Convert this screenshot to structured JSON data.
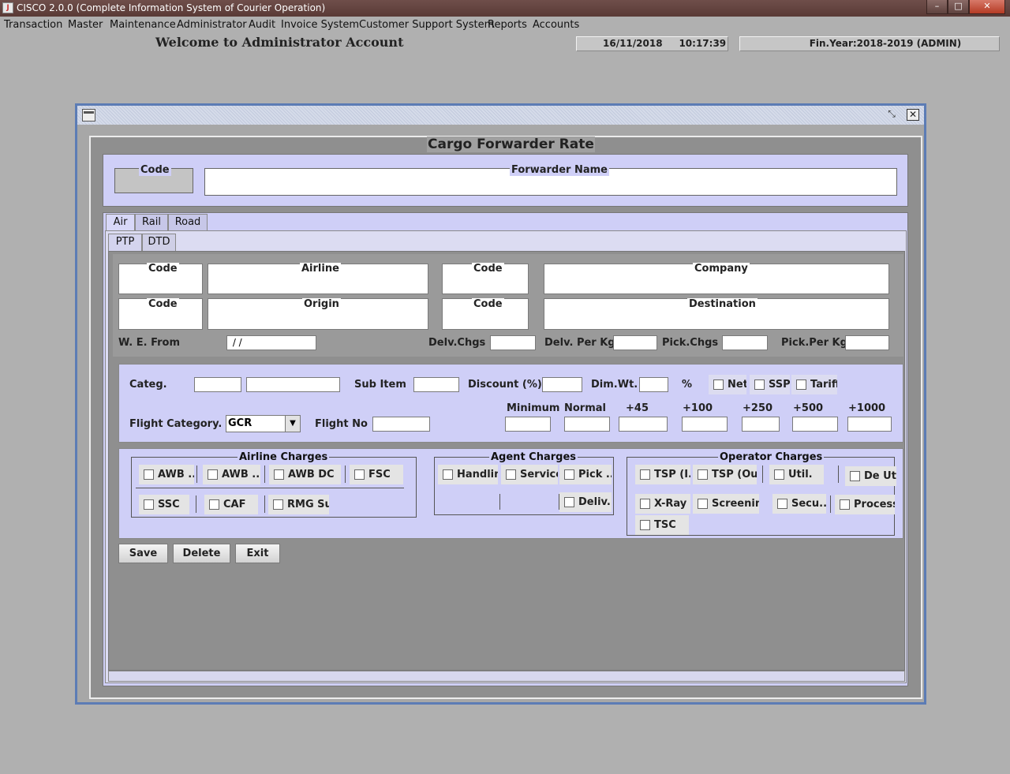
{
  "window": {
    "title": "CISCO 2.0.0 (Complete Information System of Courier Operation)",
    "buttons": [
      "–",
      "□",
      "✕"
    ]
  },
  "menubar": [
    "Transaction",
    "Master",
    "Maintenance",
    "Administrator",
    "Audit",
    "Invoice System",
    "Customer Support System",
    "Reports",
    "Accounts"
  ],
  "header": {
    "welcome": "Welcome to Administrator Account",
    "datetime": "16/11/2018     10:17:39",
    "finyear": "Fin.Year:2018-2019  (ADMIN)"
  },
  "form": {
    "title": "Cargo Forwarder Rate",
    "code_label": "Code",
    "forwarder_name_label": "Forwarder Name",
    "mode_tabs": [
      "Air",
      "Rail",
      "Road"
    ],
    "sub_tabs": [
      "PTP",
      "DTD"
    ],
    "route": {
      "code1": "Code",
      "airline": "Airline",
      "code2": "Code",
      "company": "Company",
      "code3": "Code",
      "origin": "Origin",
      "code4": "Code",
      "destination": "Destination"
    },
    "charges_row": {
      "we_from_label": "W. E. From",
      "we_from_value": " / /",
      "delv_chgs": "Delv.Chgs",
      "delv_per_kg": "Delv. Per Kg",
      "pick_chgs": "Pick.Chgs",
      "pick_per_kg": "Pick.Per Kg"
    },
    "rate": {
      "categ": "Categ.",
      "sub_item": "Sub Item",
      "discount": "Discount (%)",
      "dim_wt": "Dim.Wt.",
      "percent": "%",
      "net": "Net",
      "ssp": "SSP",
      "tariff": "Tariff",
      "flight_category": "Flight Category.",
      "flight_category_value": "GCR",
      "flight_no": "Flight No",
      "slabs": [
        "Minimum",
        "Normal",
        "+45",
        "+100",
        "+250",
        "+500",
        "+1000"
      ]
    },
    "airline_charges": {
      "legend": "Airline Charges",
      "items": [
        "AWB ...",
        "AWB ...",
        "AWB DC",
        "FSC",
        "SSC",
        "CAF",
        "RMG Sur"
      ]
    },
    "agent_charges": {
      "legend": "Agent Charges",
      "items": [
        "Handling",
        "Service",
        "Pick ...",
        "Deliv..."
      ]
    },
    "operator_charges": {
      "legend": "Operator Charges",
      "items": [
        "TSP (I...",
        "TSP (Out)",
        "Util.",
        "De Util.",
        "X-Ray",
        "Screening",
        "Secu...",
        "Processin",
        "TSC"
      ]
    },
    "buttons": {
      "save": "Save",
      "delete": "Delete",
      "exit": "Exit"
    }
  }
}
